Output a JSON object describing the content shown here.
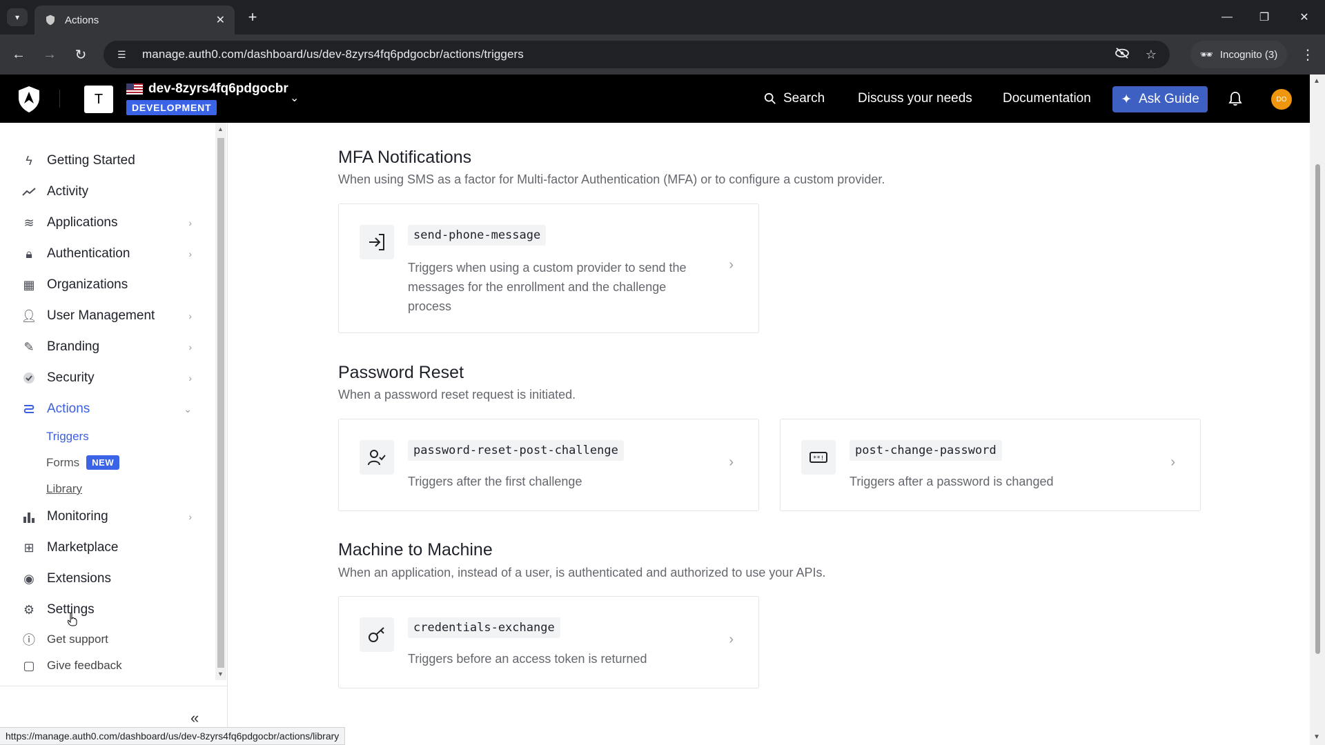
{
  "browser": {
    "tab_title": "Actions",
    "url": "manage.auth0.com/dashboard/us/dev-8zyrs4fq6pdgocbr/actions/triggers",
    "incognito_label": "Incognito (3)",
    "status_url": "https://manage.auth0.com/dashboard/us/dev-8zyrs4fq6pdgocbr/actions/library"
  },
  "header": {
    "tenant_initial": "T",
    "tenant_name": "dev-8zyrs4fq6pdgocbr",
    "environment": "DEVELOPMENT",
    "search_label": "Search",
    "discuss_label": "Discuss your needs",
    "docs_label": "Documentation",
    "ask_guide_label": "Ask Guide",
    "user_initials": "DO"
  },
  "sidebar": {
    "items": [
      {
        "label": "Getting Started",
        "icon": "bolt-icon"
      },
      {
        "label": "Activity",
        "icon": "activity-icon"
      },
      {
        "label": "Applications",
        "icon": "layers-icon"
      },
      {
        "label": "Authentication",
        "icon": "lock-icon"
      },
      {
        "label": "Organizations",
        "icon": "building-icon"
      },
      {
        "label": "User Management",
        "icon": "users-icon"
      },
      {
        "label": "Branding",
        "icon": "brush-icon"
      },
      {
        "label": "Security",
        "icon": "shield-check-icon"
      },
      {
        "label": "Actions",
        "icon": "actions-icon"
      },
      {
        "label": "Monitoring",
        "icon": "bar-chart-icon"
      },
      {
        "label": "Marketplace",
        "icon": "marketplace-icon"
      },
      {
        "label": "Extensions",
        "icon": "extension-icon"
      },
      {
        "label": "Settings",
        "icon": "gear-icon"
      }
    ],
    "sub_items": {
      "triggers": "Triggers",
      "forms": "Forms",
      "forms_badge": "NEW",
      "library": "Library"
    },
    "get_support": "Get support",
    "give_feedback": "Give feedback"
  },
  "sections": {
    "mfa": {
      "title": "MFA Notifications",
      "desc": "When using SMS as a factor for Multi-factor Authentication (MFA) or to configure a custom provider.",
      "cards": [
        {
          "name": "send-phone-message",
          "desc": "Triggers when using a custom provider to send the messages for the enrollment and the challenge process"
        }
      ]
    },
    "password_reset": {
      "title": "Password Reset",
      "desc": "When a password reset request is initiated.",
      "cards": [
        {
          "name": "password-reset-post-challenge",
          "desc": "Triggers after the first challenge"
        },
        {
          "name": "post-change-password",
          "desc": "Triggers after a password is changed"
        }
      ]
    },
    "m2m": {
      "title": "Machine to Machine",
      "desc": "When an application, instead of a user, is authenticated and authorized to use your APIs.",
      "cards": [
        {
          "name": "credentials-exchange",
          "desc": "Triggers before an access token is returned"
        }
      ]
    }
  }
}
